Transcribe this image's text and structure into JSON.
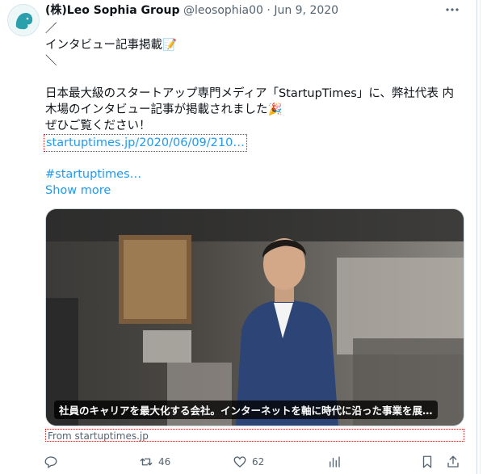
{
  "author": {
    "display_name": "(株)Leo Sophia Group",
    "handle": "@leosophia00",
    "separator": "·",
    "date": "Jun 9, 2020"
  },
  "more_label": "···",
  "tweet": {
    "line1": "／",
    "line2": "インタビュー記事掲載📝",
    "line3": "＼",
    "line4": "日本最大級のスタートアップ専門メディア「StartupTimes」に、弊社代表 内",
    "line5": "木場のインタビュー記事が掲載されました🎉",
    "line6": "ぜひご覧ください！",
    "link": "startuptimes.jp/2020/06/09/210…",
    "hashtag": "#startuptimes…",
    "show_more": "Show more"
  },
  "media": {
    "caption": "社員のキャリアを最大化する会社。インターネットを軸に時代に沿った事業を展…",
    "source": "From startuptimes.jp"
  },
  "actions": {
    "reply": {
      "icon": "reply-icon",
      "count": ""
    },
    "retweet": {
      "icon": "retweet-icon",
      "count": "46"
    },
    "like": {
      "icon": "heart-icon",
      "count": "62"
    },
    "views": {
      "icon": "analytics-icon",
      "count": ""
    },
    "bookmark": {
      "icon": "bookmark-icon",
      "count": ""
    },
    "share": {
      "icon": "share-icon",
      "count": ""
    }
  },
  "colors": {
    "link": "#1d9bf0",
    "muted": "#536471",
    "text": "#0f1419"
  }
}
